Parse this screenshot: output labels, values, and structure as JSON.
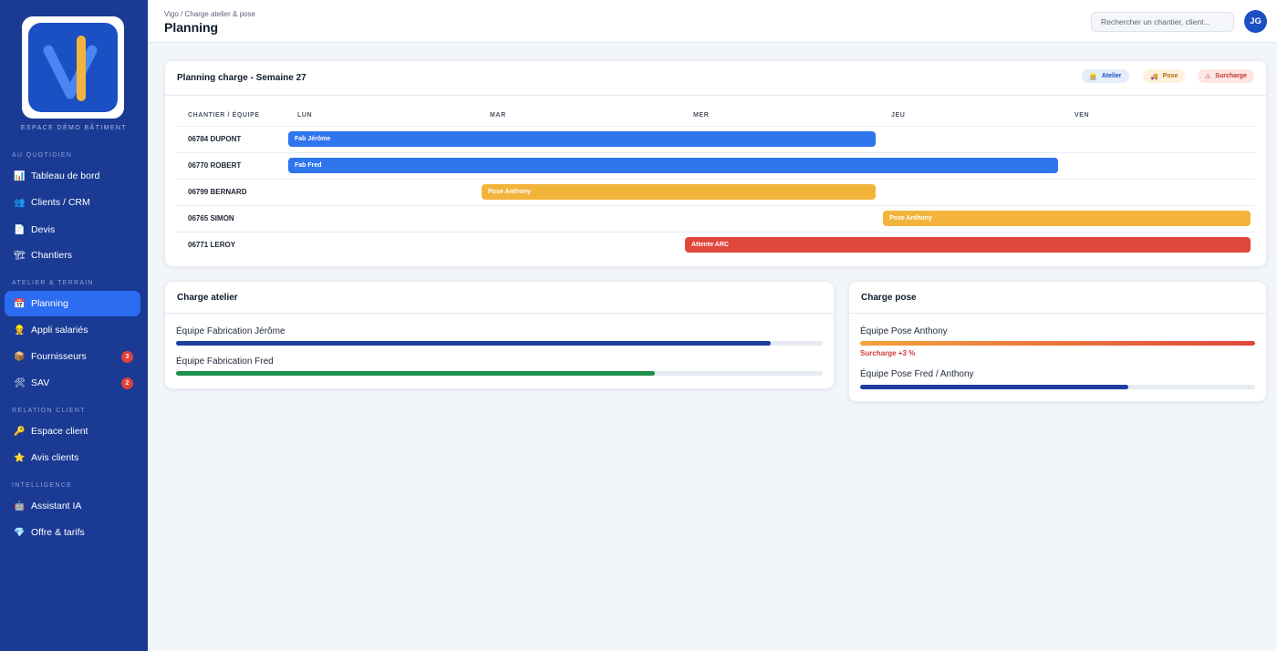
{
  "sidebar": {
    "logo_subtitle": "ESPACE DÉMO BÂTIMENT",
    "sections": {
      "quotidien": "AU QUOTIDIEN",
      "atelier": "ATELIER & TERRAIN",
      "relation": "RELATION CLIENT",
      "intelligence": "INTELLIGENCE"
    },
    "items": [
      {
        "label": "Tableau de bord",
        "icon": "bar-chart-icon",
        "glyph": "📊"
      },
      {
        "label": "Clients / CRM",
        "icon": "people-icon",
        "glyph": "👥"
      },
      {
        "label": "Devis",
        "icon": "document-icon",
        "glyph": "📄"
      },
      {
        "label": "Chantiers",
        "icon": "building-icon",
        "glyph": "🏗"
      },
      {
        "label": "Planning",
        "icon": "calendar-icon",
        "glyph": "📅",
        "active": true
      },
      {
        "label": "Appli salariés",
        "icon": "worker-icon",
        "glyph": "👷"
      },
      {
        "label": "Fournisseurs",
        "icon": "package-icon",
        "glyph": "📦",
        "badge": "3"
      },
      {
        "label": "SAV",
        "icon": "tools-icon",
        "glyph": "🛠",
        "badge": "2"
      },
      {
        "label": "Espace client",
        "icon": "key-icon",
        "glyph": "🔑"
      },
      {
        "label": "Avis clients",
        "icon": "star-icon",
        "glyph": "⭐"
      },
      {
        "label": "Assistant IA",
        "icon": "robot-icon",
        "glyph": "🤖"
      },
      {
        "label": "Offre & tarifs",
        "icon": "diamond-icon",
        "glyph": "💎"
      }
    ]
  },
  "header": {
    "breadcrumb": "Vigo / Charge atelier & pose",
    "title": "Planning",
    "search_placeholder": "Rechercher un chantier, client...",
    "avatar_initials": "JG"
  },
  "planning": {
    "title": "Planning charge - Semaine 27",
    "legend": [
      {
        "label": "Atelier",
        "icon": "worker-icon",
        "glyph": "👷",
        "bg": "#e3edfc",
        "color": "#1b4fc4"
      },
      {
        "label": "Pose",
        "icon": "truck-icon",
        "glyph": "🚚",
        "bg": "#fdf1dd",
        "color": "#b06a10"
      },
      {
        "label": "Surcharge",
        "icon": "warning-icon",
        "glyph": "⚠",
        "bg": "#fde6e4",
        "color": "#c0392b"
      }
    ],
    "columns": [
      "CHANTIER / ÉQUIPE",
      "LUN",
      "MAR",
      "MER",
      "JEU",
      "VEN"
    ],
    "rows": [
      {
        "chantier": "06784 DUPONT",
        "task": "Fab Jérôme",
        "type": "atelier",
        "start": 0,
        "end": 3
      },
      {
        "chantier": "06770 ROBERT",
        "task": "Fab Fred",
        "type": "atelier",
        "start": 0,
        "end": 4
      },
      {
        "chantier": "06799 BERNARD",
        "task": "Pose Anthony",
        "type": "pose",
        "start": 1,
        "end": 3
      },
      {
        "chantier": "06765 SIMON",
        "task": "Pose Anthony",
        "type": "pose",
        "start": 3,
        "end": 5
      },
      {
        "chantier": "06771 LEROY",
        "task": "Attente ARC",
        "type": "surcharge",
        "start": 2,
        "end": 5
      }
    ],
    "colors": {
      "atelier": "#2f75ee",
      "pose": "#f3b43c",
      "surcharge": "#e0473c"
    }
  },
  "charge_atelier": {
    "title": "Charge atelier",
    "teams": [
      {
        "label": "Équipe Fabrication Jérôme",
        "percent": 92,
        "color": "#1c3f9e"
      },
      {
        "label": "Équipe Fabrication Fred",
        "percent": 74,
        "color": "#1d8f4e"
      }
    ]
  },
  "charge_pose": {
    "title": "Charge pose",
    "teams": [
      {
        "label": "Équipe Pose Anthony",
        "percent": 103,
        "color": "#e0473c",
        "warning": "Surcharge +3 %"
      },
      {
        "label": "Équipe Pose Fred / Anthony",
        "percent": 68,
        "color": "#1c3f9e"
      }
    ]
  }
}
